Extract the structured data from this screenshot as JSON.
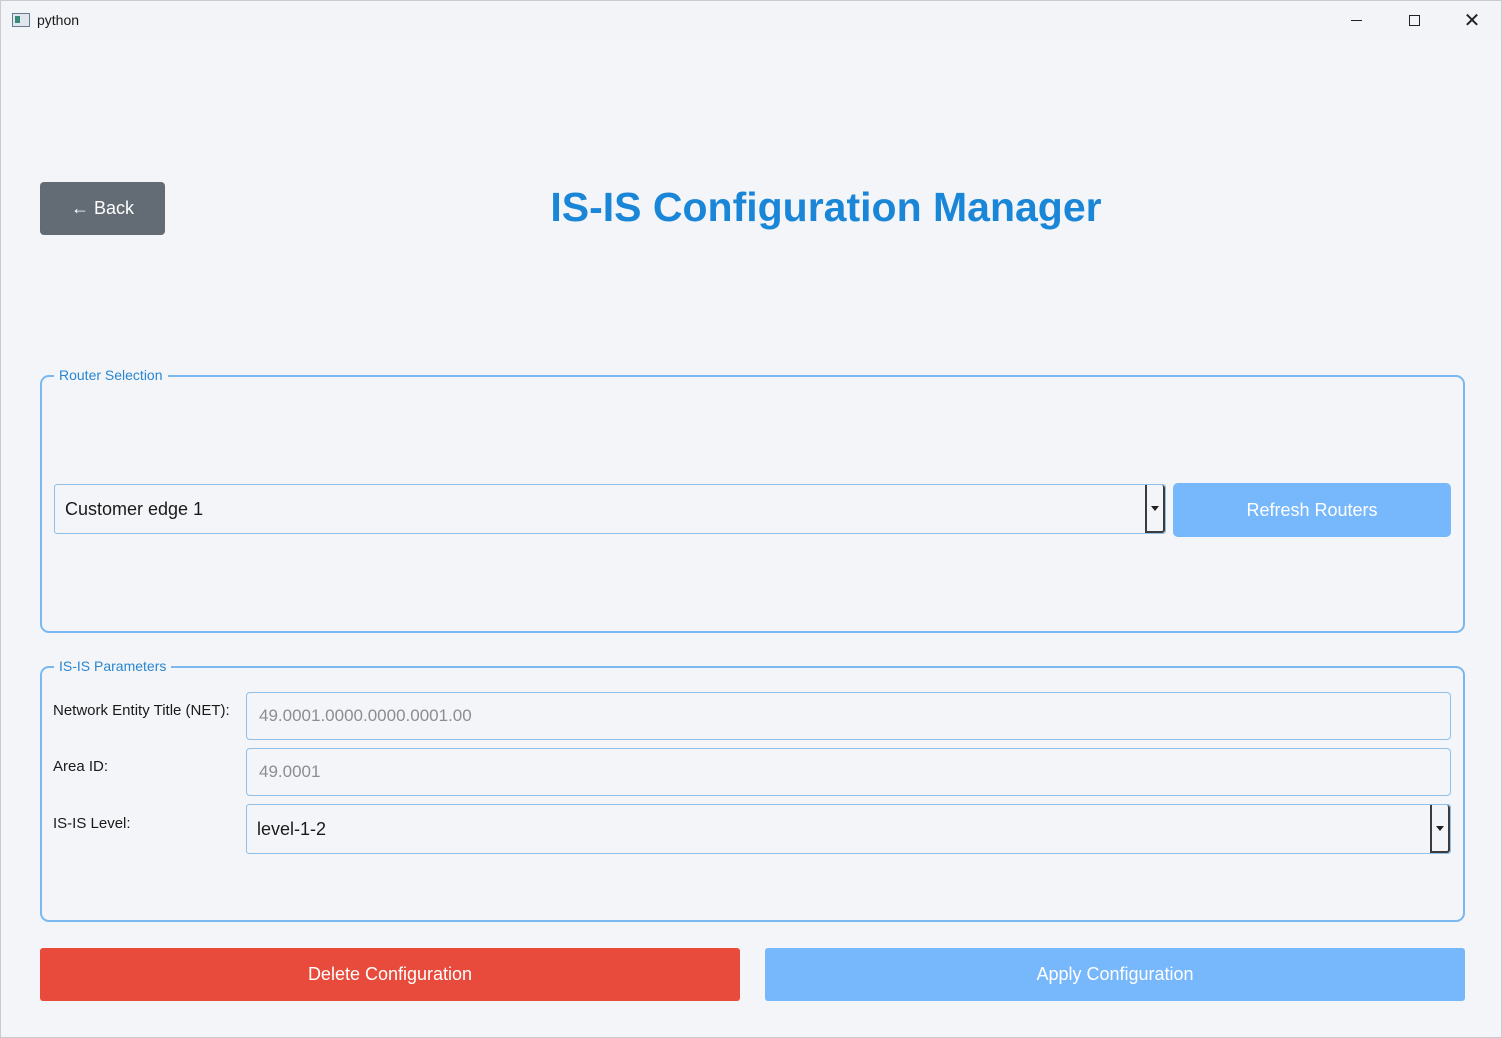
{
  "window": {
    "title": "python",
    "minimize_icon": "minimize-icon",
    "maximize_icon": "maximize-icon",
    "close_icon": "close-icon",
    "close_glyph": "✕"
  },
  "header": {
    "back_label": "← Back",
    "title": "IS-IS Configuration Manager"
  },
  "router_selection": {
    "legend": "Router Selection",
    "selected_router": "Customer edge 1",
    "refresh_label": "Refresh Routers"
  },
  "isis_parameters": {
    "legend": "IS-IS Parameters",
    "net_label": "Network Entity Title (NET):",
    "net_placeholder": "49.0001.0000.0000.0001.00",
    "area_label": "Area ID:",
    "area_placeholder": "49.0001",
    "level_label": "IS-IS Level:",
    "level_selected": "level-1-2"
  },
  "actions": {
    "delete_label": "Delete Configuration",
    "apply_label": "Apply Configuration"
  },
  "colors": {
    "accent": "#1a86d8",
    "button_blue": "#77b7fb",
    "delete_red": "#e84b3c",
    "back_gray": "#636c74"
  }
}
